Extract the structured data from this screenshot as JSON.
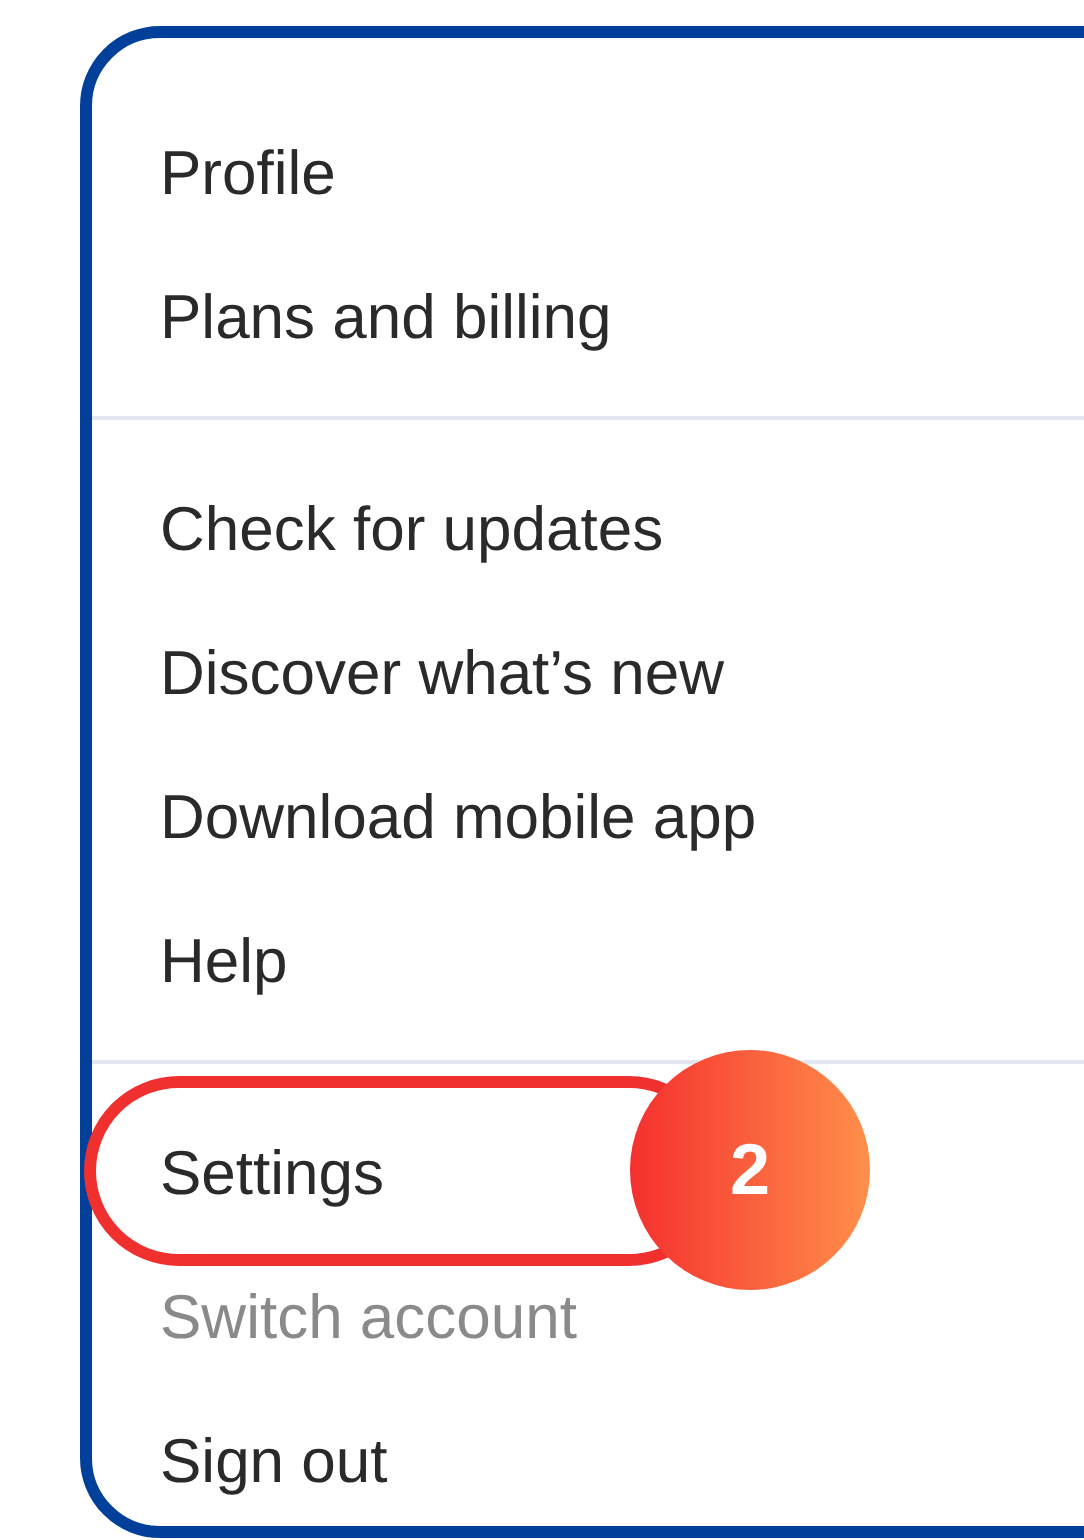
{
  "menu": {
    "sections": [
      {
        "items": [
          {
            "label": "Profile",
            "disabled": false,
            "highlighted": false
          },
          {
            "label": "Plans and billing",
            "disabled": false,
            "highlighted": false
          }
        ]
      },
      {
        "items": [
          {
            "label": "Check for updates",
            "disabled": false,
            "highlighted": false
          },
          {
            "label": "Discover what’s new",
            "disabled": false,
            "highlighted": false
          },
          {
            "label": "Download mobile app",
            "disabled": false,
            "highlighted": false
          },
          {
            "label": "Help",
            "disabled": false,
            "highlighted": false
          }
        ]
      },
      {
        "items": [
          {
            "label": "Settings",
            "disabled": false,
            "highlighted": true,
            "step": "2"
          },
          {
            "label": "Switch account",
            "disabled": true,
            "highlighted": false
          },
          {
            "label": "Sign out",
            "disabled": false,
            "highlighted": false
          }
        ]
      }
    ]
  }
}
